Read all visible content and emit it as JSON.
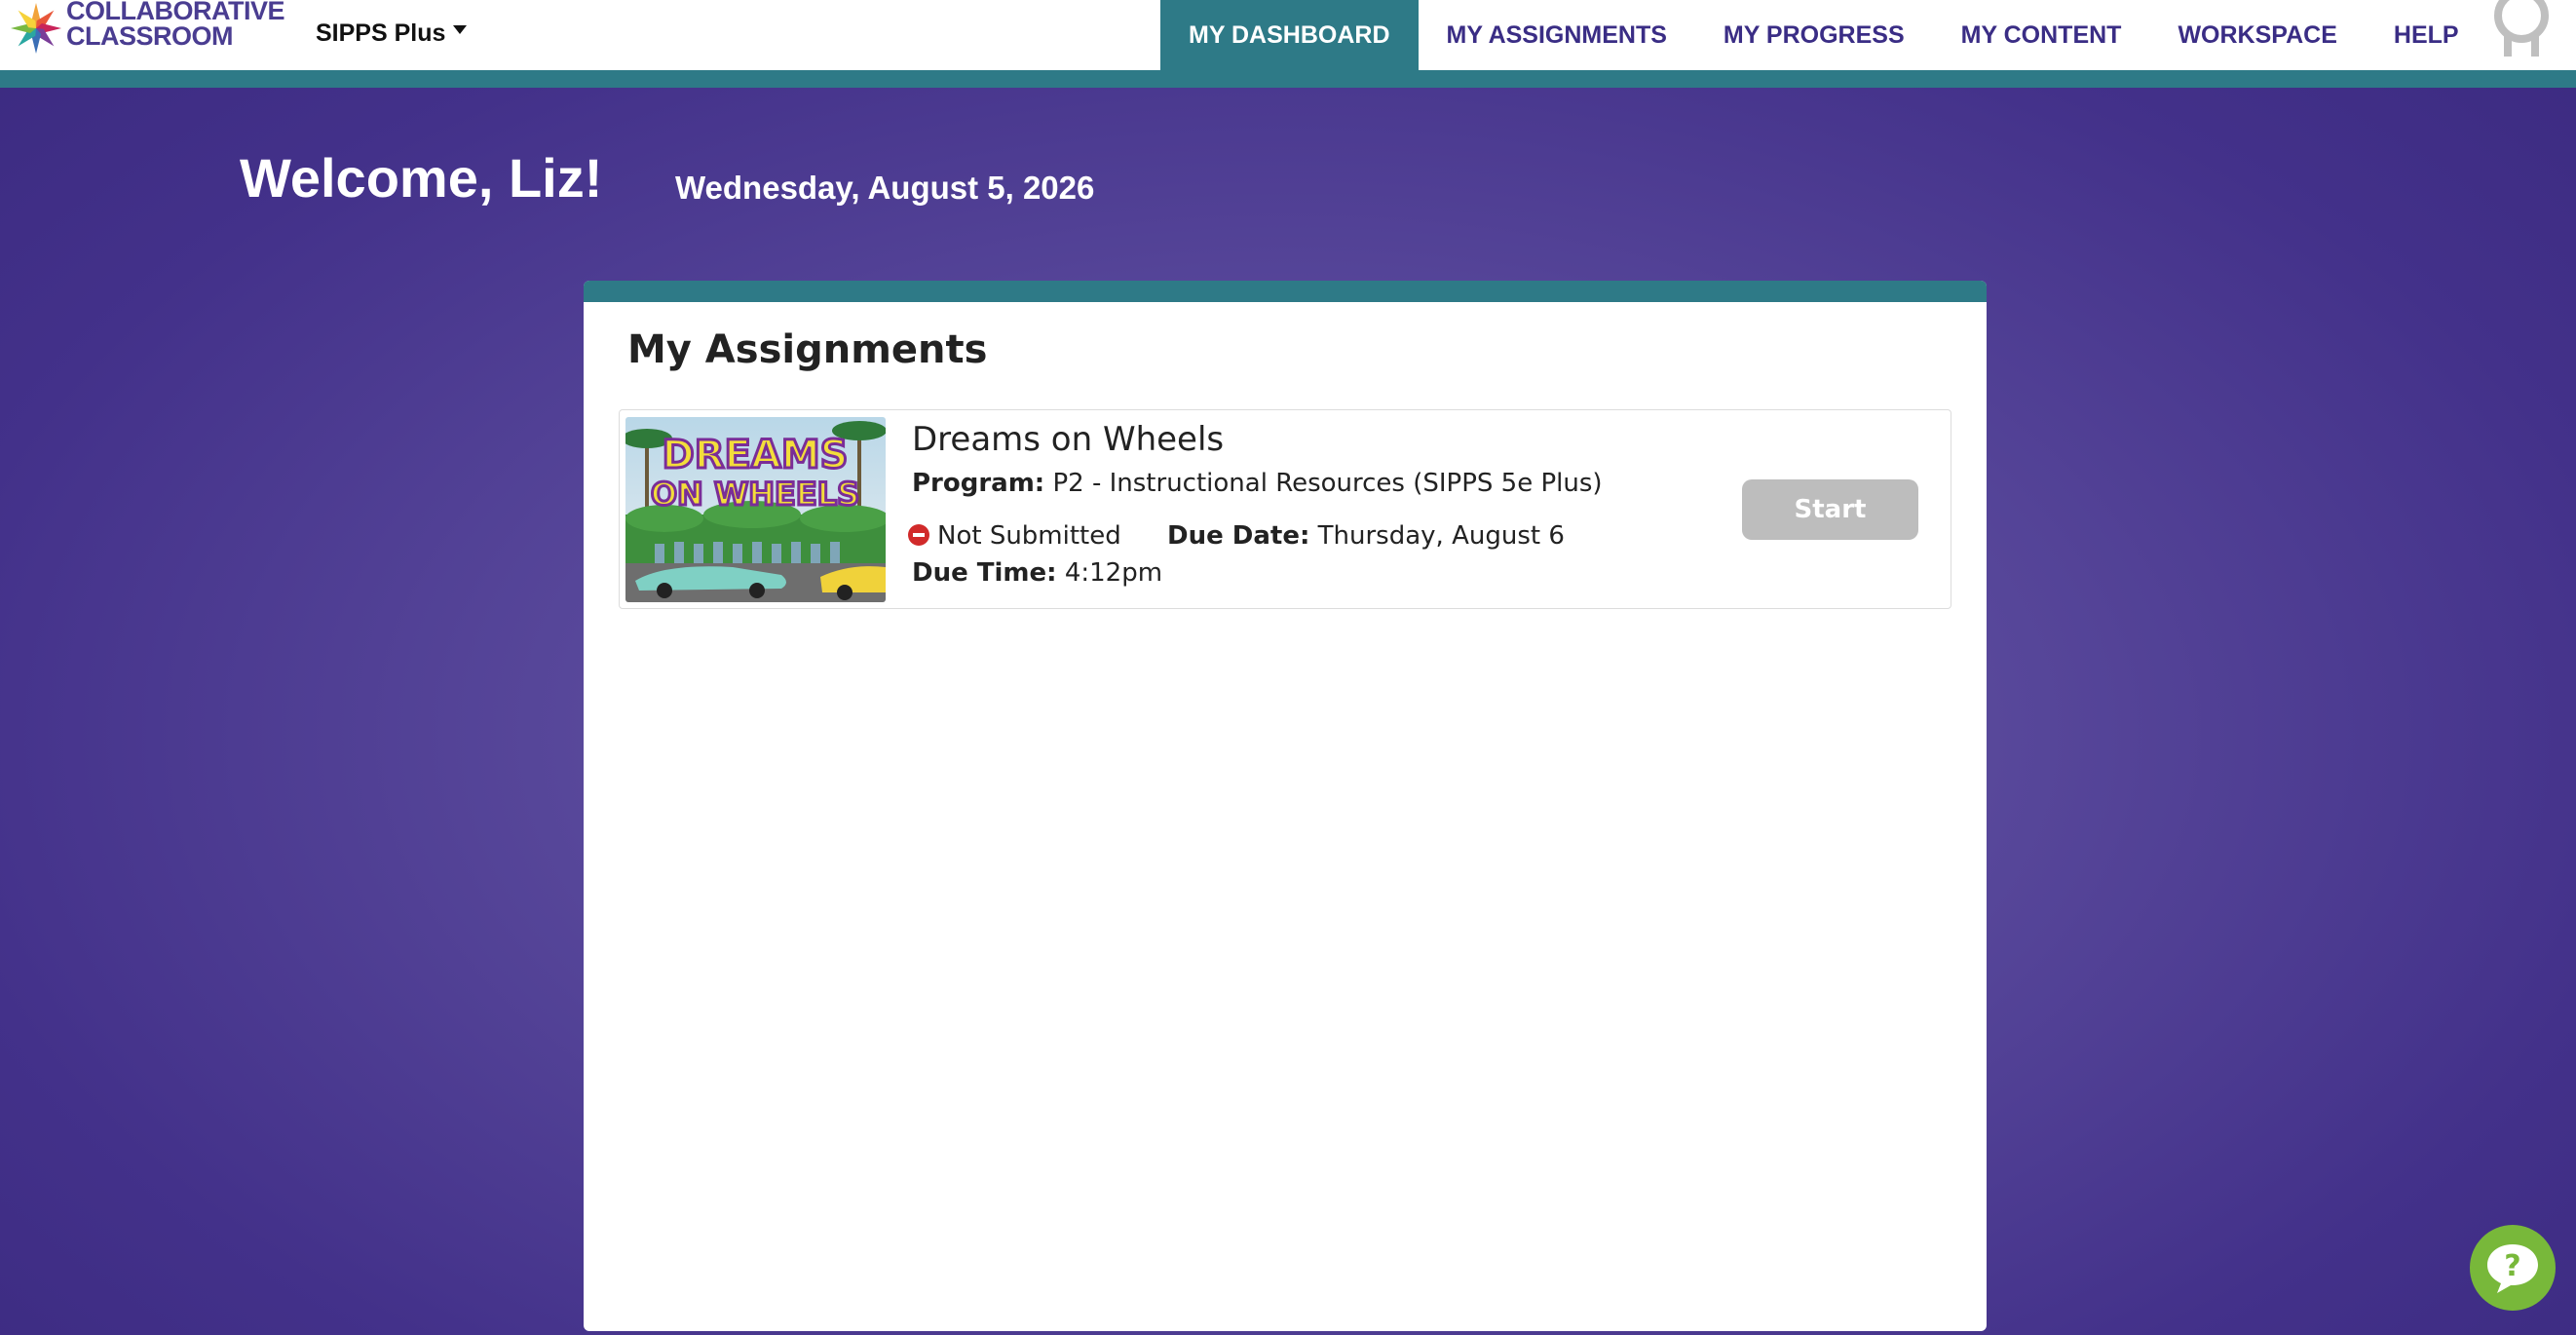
{
  "brand": {
    "logo_line1": "COLLABORATIVE",
    "logo_line2": "CLASSROOM",
    "logo_icon": "star-burst-logo"
  },
  "program_selector": {
    "value": "SIPPS Plus",
    "icon": "caret-down-icon"
  },
  "nav": {
    "items": [
      {
        "label": "MY DASHBOARD",
        "active": true
      },
      {
        "label": "MY ASSIGNMENTS",
        "active": false
      },
      {
        "label": "MY PROGRESS",
        "active": false
      },
      {
        "label": "MY CONTENT",
        "active": false
      },
      {
        "label": "WORKSPACE",
        "active": false
      },
      {
        "label": "HELP",
        "active": false
      }
    ],
    "avatar_icon": "user-avatar-icon"
  },
  "welcome": {
    "greeting": "Welcome, Liz!",
    "date": "Wednesday, August 5, 2026"
  },
  "assignments": {
    "title": "My Assignments",
    "items": [
      {
        "title": "Dreams on Wheels",
        "program_label": "Program:",
        "program_value": "P2 - Instructional Resources (SIPPS 5e Plus)",
        "status": "Not Submitted",
        "due_date_label": "Due Date:",
        "due_date_value": "Thursday, August 6",
        "due_time_label": "Due Time:",
        "due_time_value": "4:12pm",
        "thumbnail_text_1": "DREAMS",
        "thumbnail_text_2": "ON WHEELS",
        "start_label": "Start"
      }
    ]
  },
  "colors": {
    "teal": "#2e7a87",
    "purple_nav": "#3a2d85",
    "status_red": "#d12a2a",
    "help_green": "#78b83a",
    "button_disabled": "#bdbdbd"
  },
  "help_fab_icon": "question-chat-icon"
}
